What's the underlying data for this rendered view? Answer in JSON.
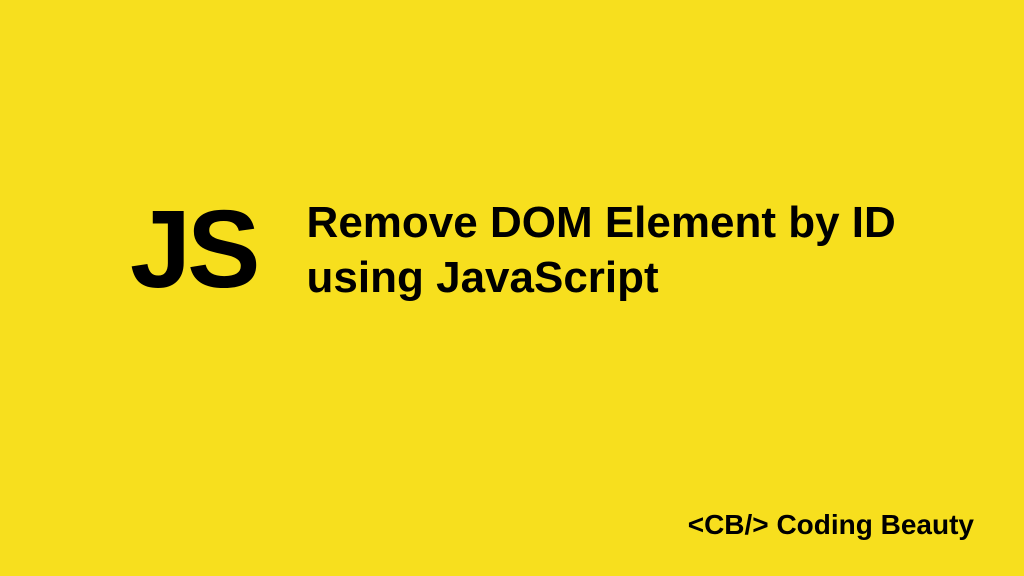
{
  "logo": "JS",
  "title": "Remove DOM Element by ID using JavaScript",
  "brand": "<CB/> Coding Beauty"
}
